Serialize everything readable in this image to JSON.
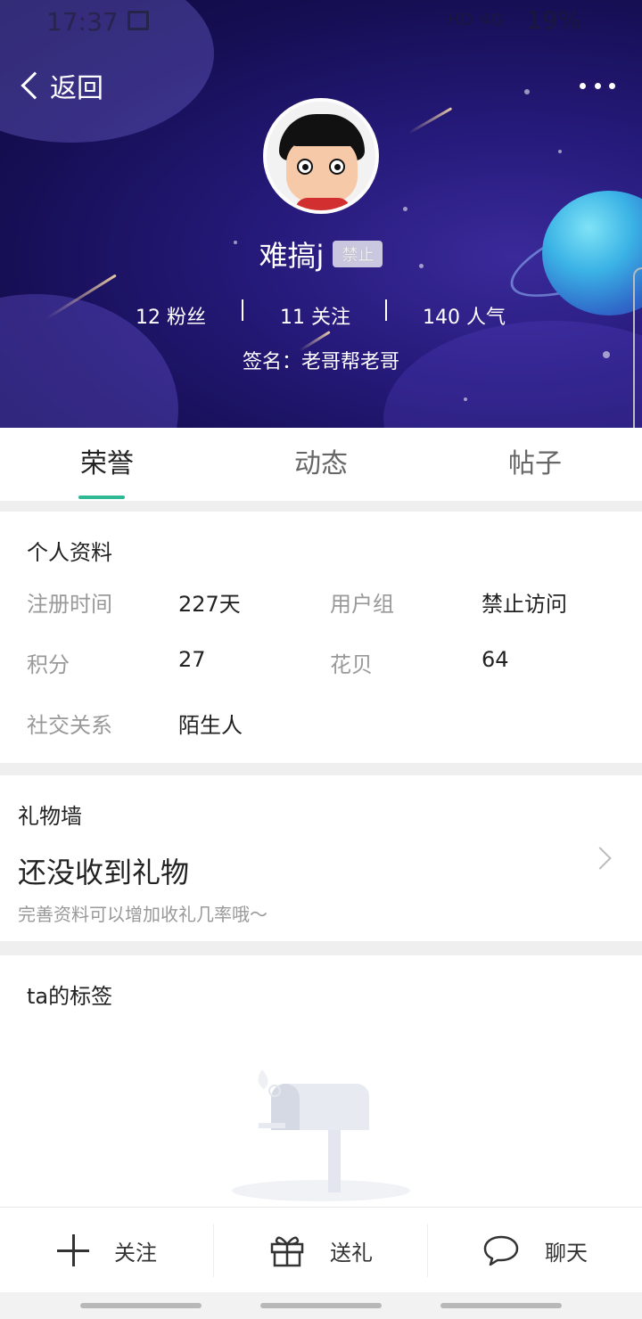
{
  "status_bar": {
    "time": "17:37",
    "network": "HD 4G",
    "battery": "19%"
  },
  "header": {
    "back_label": "返回",
    "username": "难搞j",
    "badge": "禁止",
    "stats": [
      {
        "value": "12",
        "label": "粉丝"
      },
      {
        "value": "11",
        "label": "关注"
      },
      {
        "value": "140",
        "label": "人气"
      }
    ],
    "signature_label": "签名：",
    "signature": "老哥帮老哥"
  },
  "tabs": [
    {
      "label": "荣誉",
      "active": true
    },
    {
      "label": "动态",
      "active": false
    },
    {
      "label": "帖子",
      "active": false
    }
  ],
  "profile": {
    "title": "个人资料",
    "register_label": "注册时间",
    "register_value": "227天",
    "group_label": "用户组",
    "group_value": "禁止访问",
    "points_label": "积分",
    "points_value": "27",
    "shells_label": "花贝",
    "shells_value": "64",
    "social_label": "社交关系",
    "social_value": "陌生人"
  },
  "gift_wall": {
    "title": "礼物墙",
    "empty_text": "还没收到礼物",
    "hint": "完善资料可以增加收礼几率哦～"
  },
  "tags": {
    "title": "ta的标签"
  },
  "bottom_bar": {
    "follow_label": "关注",
    "gift_label": "送礼",
    "chat_label": "聊天"
  },
  "colors": {
    "accent": "#2fb894",
    "header_bg": "#1a1260"
  }
}
